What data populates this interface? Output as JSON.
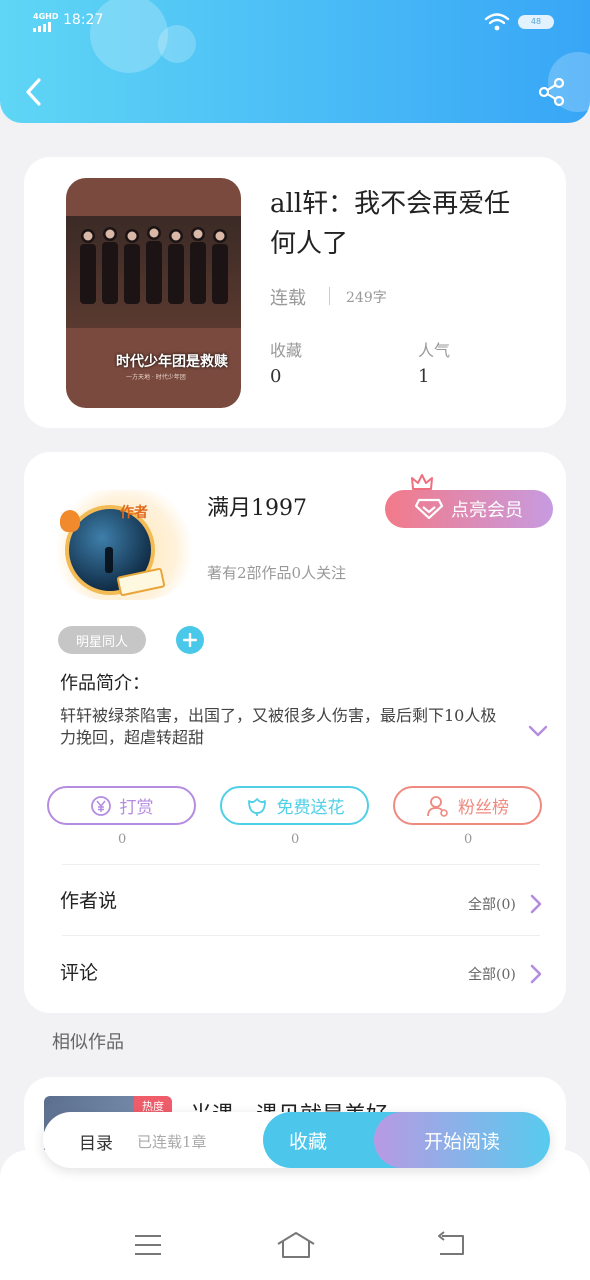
{
  "status_bar": {
    "network": "4GHD",
    "time": "18:27",
    "battery": "48"
  },
  "book": {
    "title": "all轩：我不会再爱任何人了",
    "status": "连载",
    "words": "249字",
    "collect_label": "收藏",
    "collect_value": "0",
    "popularity_label": "人气",
    "popularity_value": "1",
    "cover_text": "时代少年团是救赎",
    "cover_subtext": "一方天地 · 时代少年团"
  },
  "author": {
    "badge": "作者",
    "name": "满月1997",
    "vip_button": "点亮会员",
    "stats": "著有2部作品0人关注",
    "tag": "明星同人",
    "intro_label": "作品简介：",
    "intro_text": "轩轩被绿茶陷害，出国了，又被很多人伤害，最后剩下10人极力挽回，超虐转超甜"
  },
  "actions": [
    {
      "label": "打赏",
      "count": "0",
      "color": "#b58ce0"
    },
    {
      "label": "免费送花",
      "count": "0",
      "color": "#4fd0e6"
    },
    {
      "label": "粉丝榜",
      "count": "0",
      "color": "#ef8a80"
    }
  ],
  "author_says": {
    "label": "作者说",
    "all": "全部(0)"
  },
  "comments": {
    "label": "评论",
    "all": "全部(0)"
  },
  "similar": {
    "heading": "相似作品",
    "item_tag": "热度",
    "item_title": "光遇，遇见就是美好"
  },
  "bottom_bar": {
    "catalog": "目录",
    "chapters": "已连载1章",
    "collect_button": "收藏",
    "read_button": "开始阅读"
  }
}
